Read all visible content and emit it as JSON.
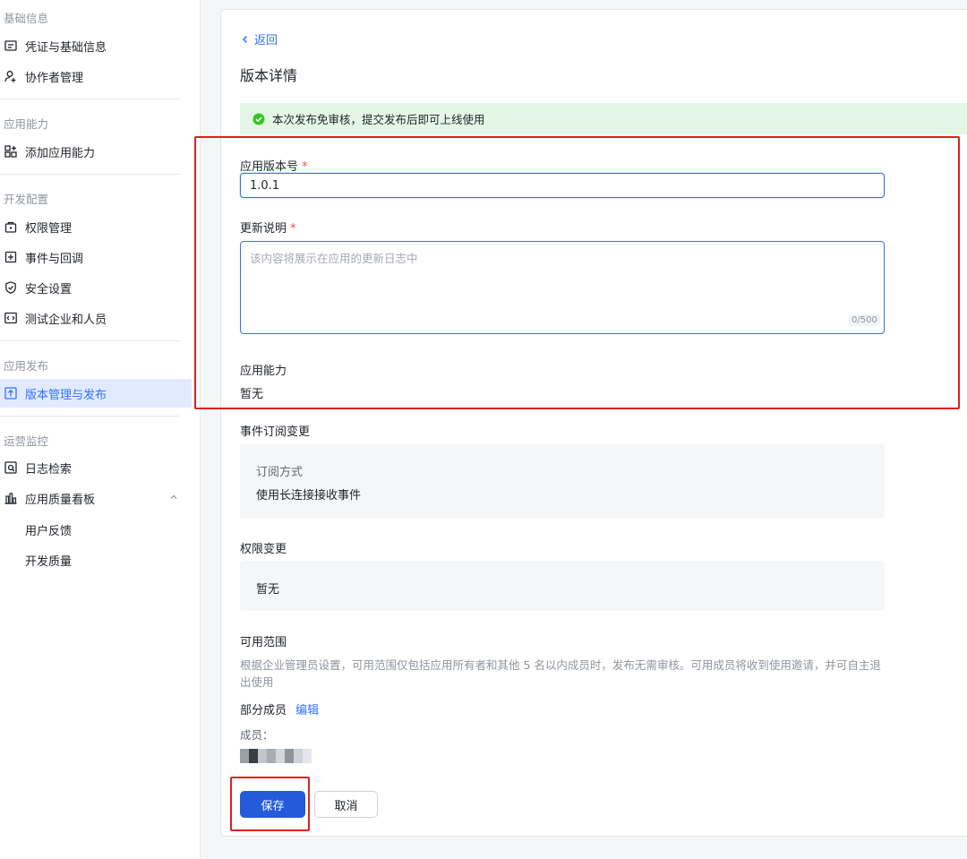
{
  "sidebar": {
    "sections": [
      {
        "title": "基础信息",
        "items": [
          {
            "label": "凭证与基础信息",
            "icon": "credential-icon"
          },
          {
            "label": "协作者管理",
            "icon": "user-add-icon"
          }
        ]
      },
      {
        "title": "应用能力",
        "items": [
          {
            "label": "添加应用能力",
            "icon": "grid-add-icon"
          }
        ]
      },
      {
        "title": "开发配置",
        "items": [
          {
            "label": "权限管理",
            "icon": "lock-icon"
          },
          {
            "label": "事件与回调",
            "icon": "event-icon"
          },
          {
            "label": "安全设置",
            "icon": "shield-icon"
          },
          {
            "label": "测试企业和人员",
            "icon": "code-icon"
          }
        ]
      },
      {
        "title": "应用发布",
        "items": [
          {
            "label": "版本管理与发布",
            "icon": "upload-icon",
            "active": true
          }
        ]
      },
      {
        "title": "运营监控",
        "items": [
          {
            "label": "日志检索",
            "icon": "log-search-icon"
          },
          {
            "label": "应用质量看板",
            "icon": "bar-chart-icon"
          },
          {
            "label": "用户反馈"
          },
          {
            "label": "开发质量"
          }
        ]
      }
    ]
  },
  "main": {
    "back_label": "返回",
    "title": "版本详情",
    "notice": "本次发布免审核，提交发布后即可上线使用",
    "version": {
      "label": "应用版本号",
      "required": "*",
      "value": "1.0.1"
    },
    "changelog": {
      "label": "更新说明",
      "required": "*",
      "placeholder": "该内容将展示在应用的更新日志中",
      "counter": "0/500"
    },
    "capability": {
      "label": "应用能力",
      "value": "暂无"
    },
    "event_change": {
      "label": "事件订阅变更",
      "method_label": "订阅方式",
      "method_value": "使用长连接接收事件"
    },
    "permission_change": {
      "label": "权限变更",
      "value": "暂无"
    },
    "scope": {
      "label": "可用范围",
      "description": "根据企业管理员设置，可用范围仅包括应用所有者和其他 5 名以内成员时，发布无需审核。可用成员将收到使用邀请，并可自主退出使用",
      "members_type": "部分成员",
      "edit_label": "编辑",
      "members_label": "成员："
    },
    "save_label": "保存",
    "cancel_label": "取消"
  },
  "colors": {
    "accent": "#3370ff",
    "primary_button": "#245bdb",
    "highlight_box": "#e02020",
    "success_bg": "#e4f7e7"
  }
}
